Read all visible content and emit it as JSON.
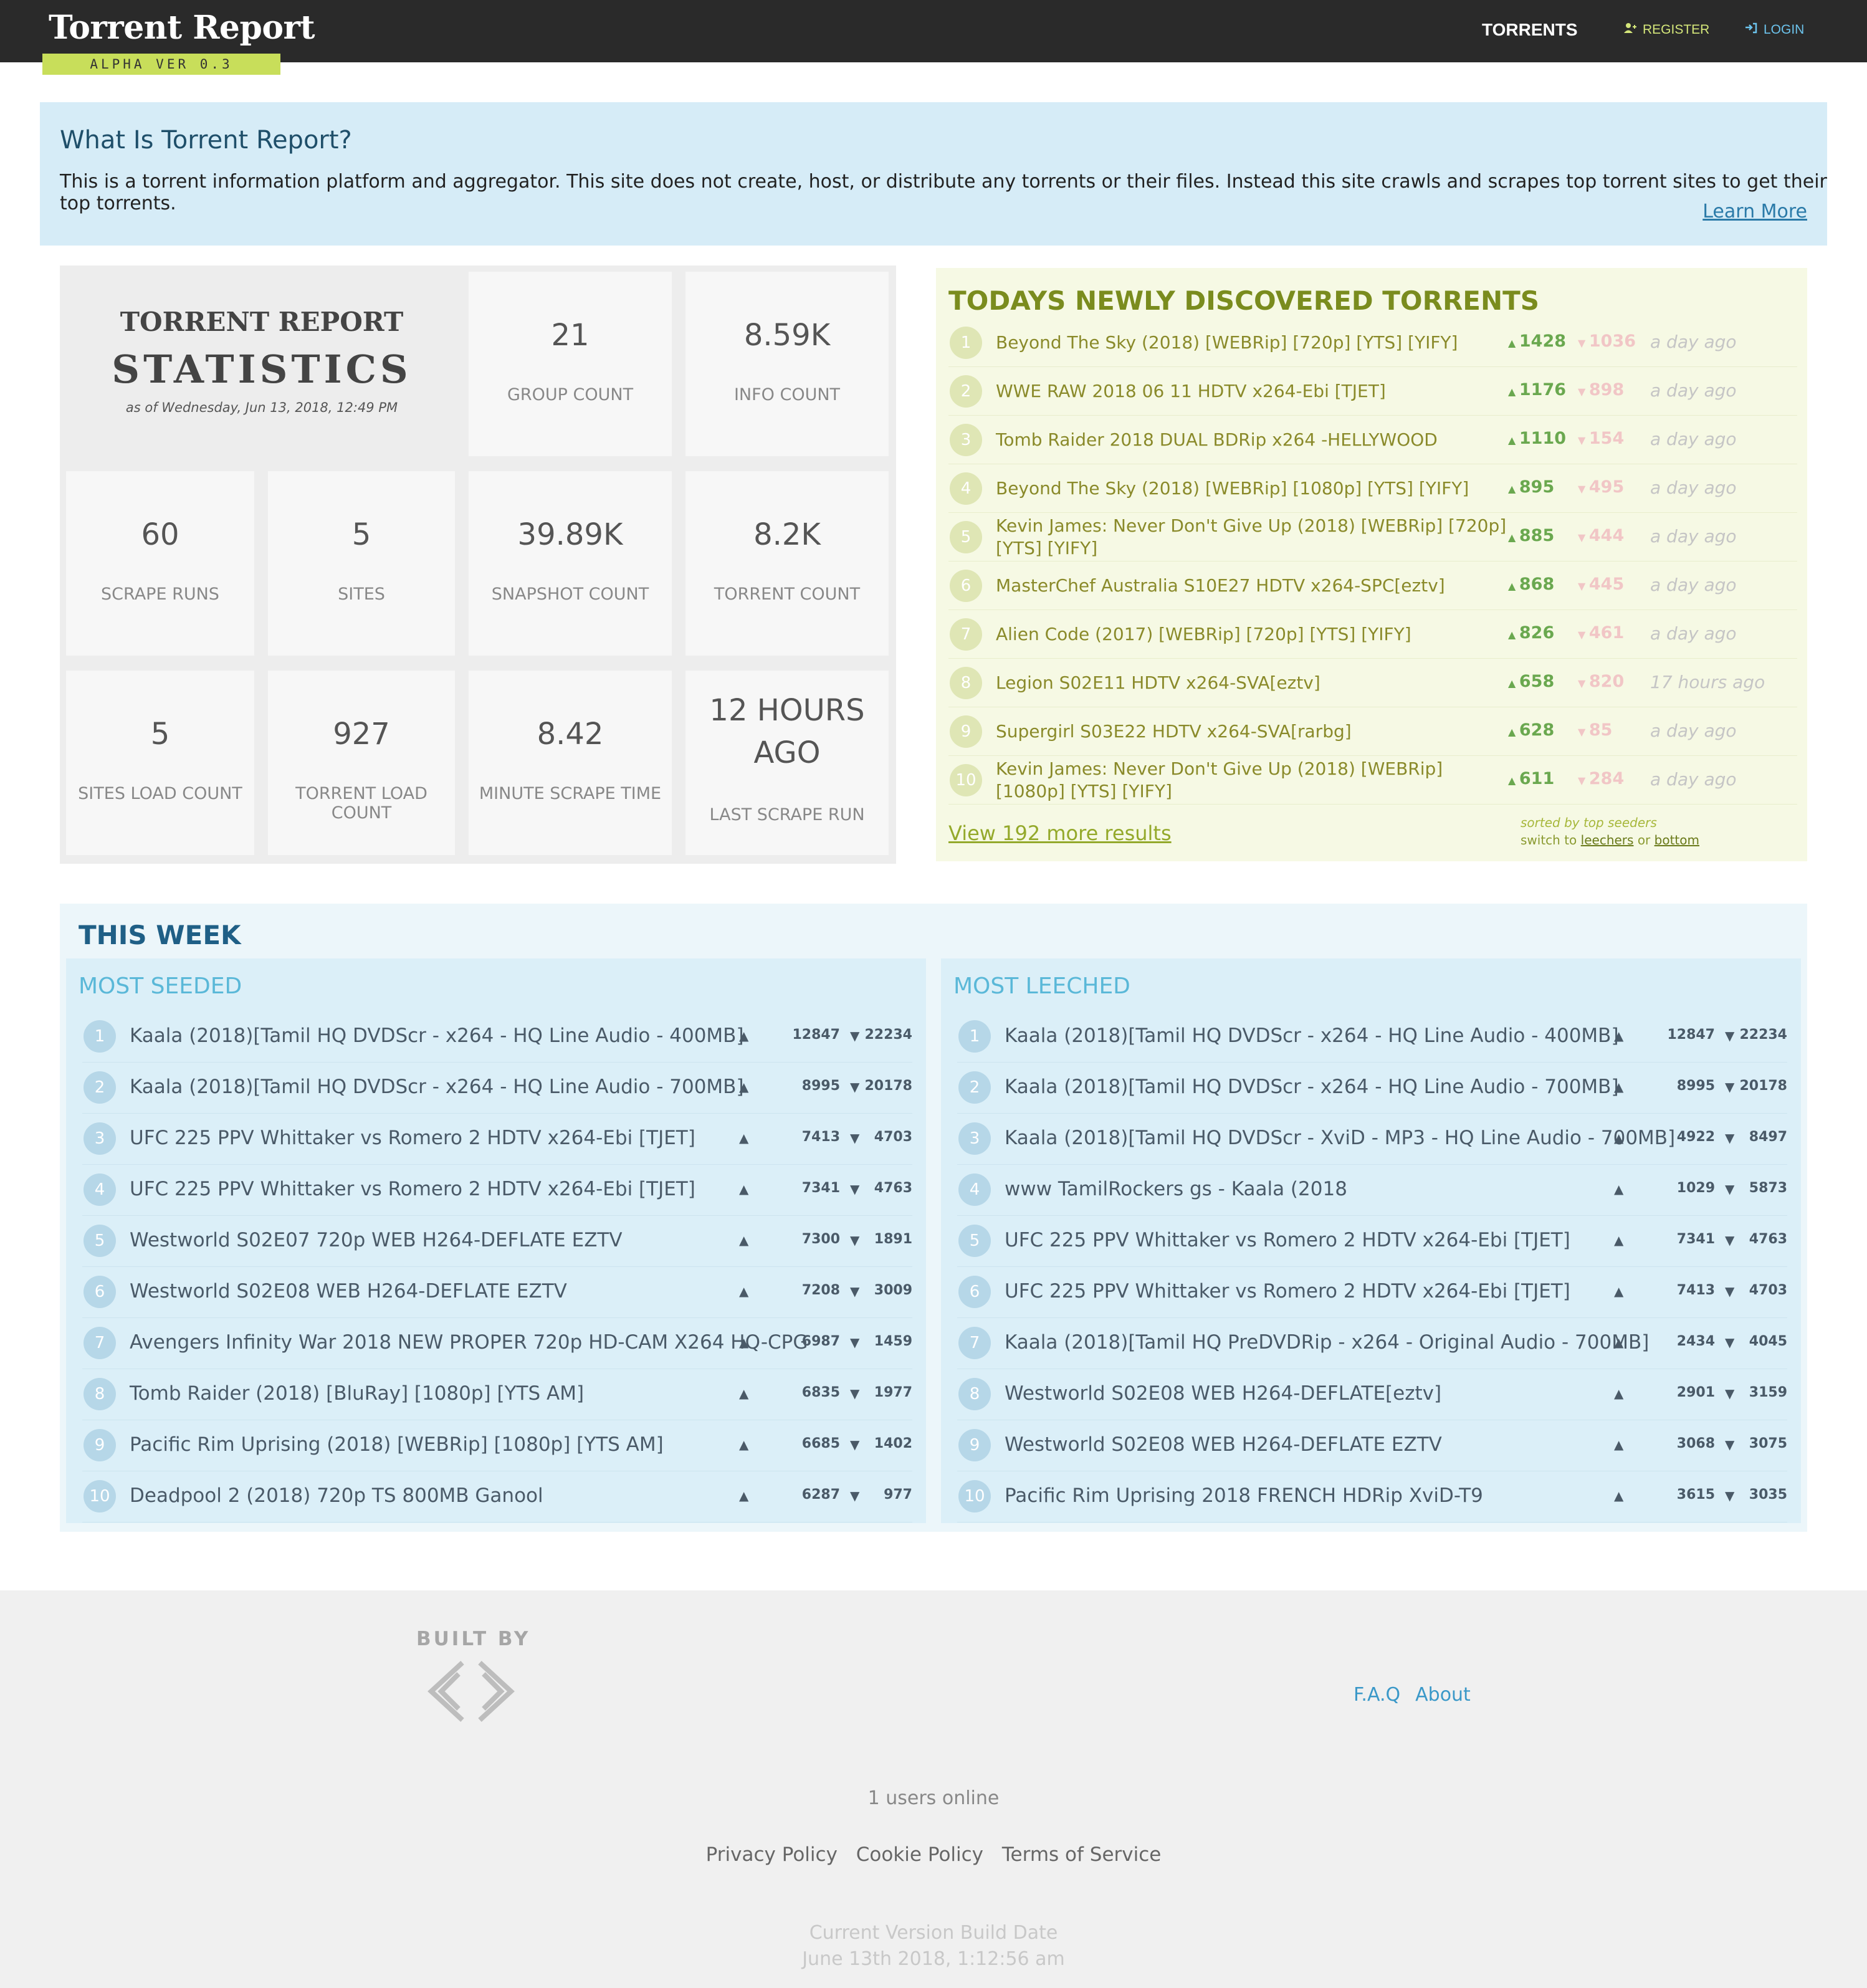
{
  "header": {
    "logo": "Torrent Report",
    "version": "ALPHA VER 0.3",
    "nav": {
      "torrents": "TORRENTS",
      "register": "REGISTER",
      "login": "LOGIN"
    }
  },
  "intro": {
    "title": "What Is Torrent Report?",
    "text": "This is a torrent information platform and aggregator. This site does not create, host, or distribute any torrents or their files. Instead this site crawls and scrapes top torrent sites to get their top torrents.",
    "learn_more": "Learn More"
  },
  "stats": {
    "heading_top": "TORRENT REPORT",
    "heading_main": "STATISTICS",
    "as_of": "as of Wednesday, Jun 13, 2018, 12:49 PM",
    "group_count": {
      "value": "21",
      "label": "GROUP COUNT"
    },
    "info_count": {
      "value": "8.59K",
      "label": "INFO COUNT"
    },
    "scrape_runs": {
      "value": "60",
      "label": "SCRAPE RUNS"
    },
    "sites": {
      "value": "5",
      "label": "SITES"
    },
    "snapshot_count": {
      "value": "39.89K",
      "label": "SNAPSHOT COUNT"
    },
    "torrent_count": {
      "value": "8.2K",
      "label": "TORRENT COUNT"
    },
    "sites_load_count": {
      "value": "5",
      "label": "SITES LOAD COUNT"
    },
    "torrent_load_count": {
      "value": "927",
      "label": "TORRENT LOAD COUNT"
    },
    "minute_scrape_time": {
      "value": "8.42",
      "label": "MINUTE SCRAPE TIME"
    },
    "last_scrape_run": {
      "value_line1": "12 HOURS",
      "value_line2": "AGO",
      "label": "LAST SCRAPE RUN"
    }
  },
  "new_torrents": {
    "title": "TODAYS NEWLY DISCOVERED TORRENTS",
    "rows": [
      {
        "num": "1",
        "name": "Beyond The Sky (2018) [WEBRip] [720p] [YTS] [YIFY]",
        "seeders": "1428",
        "leechers": "1036",
        "time": "a day ago"
      },
      {
        "num": "2",
        "name": "WWE RAW 2018 06 11 HDTV x264-Ebi [TJET]",
        "seeders": "1176",
        "leechers": "898",
        "time": "a day ago"
      },
      {
        "num": "3",
        "name": "Tomb Raider 2018 DUAL BDRip x264 -HELLYWOOD",
        "seeders": "1110",
        "leechers": "154",
        "time": "a day ago"
      },
      {
        "num": "4",
        "name": "Beyond The Sky (2018) [WEBRip] [1080p] [YTS] [YIFY]",
        "seeders": "895",
        "leechers": "495",
        "time": "a day ago"
      },
      {
        "num": "5",
        "name": "Kevin James: Never Don't Give Up (2018) [WEBRip] [720p] [YTS] [YIFY]",
        "seeders": "885",
        "leechers": "444",
        "time": "a day ago"
      },
      {
        "num": "6",
        "name": "MasterChef Australia S10E27 HDTV x264-SPC[eztv]",
        "seeders": "868",
        "leechers": "445",
        "time": "a day ago"
      },
      {
        "num": "7",
        "name": "Alien Code (2017) [WEBRip] [720p] [YTS] [YIFY]",
        "seeders": "826",
        "leechers": "461",
        "time": "a day ago"
      },
      {
        "num": "8",
        "name": "Legion S02E11 HDTV x264-SVA[eztv]",
        "seeders": "658",
        "leechers": "820",
        "time": "17 hours ago"
      },
      {
        "num": "9",
        "name": "Supergirl S03E22 HDTV x264-SVA[rarbg]",
        "seeders": "628",
        "leechers": "85",
        "time": "a day ago"
      },
      {
        "num": "10",
        "name": "Kevin James: Never Don't Give Up (2018) [WEBRip] [1080p] [YTS] [YIFY]",
        "seeders": "611",
        "leechers": "284",
        "time": "a day ago"
      }
    ],
    "view_more": "View 192 more results",
    "sorted_by": "sorted by top seeders",
    "switch_to": "switch to",
    "leechers_link": "leechers",
    "or": "or",
    "bottom_link": "bottom"
  },
  "this_week": {
    "title": "THIS WEEK",
    "most_seeded": {
      "heading": "MOST SEEDED",
      "rows": [
        {
          "num": "1",
          "name": "Kaala (2018)[Tamil HQ DVDScr - x264 - HQ Line Audio - 400MB]",
          "seeders": "12847",
          "leechers": "22234"
        },
        {
          "num": "2",
          "name": "Kaala (2018)[Tamil HQ DVDScr - x264 - HQ Line Audio - 700MB]",
          "seeders": "8995",
          "leechers": "20178"
        },
        {
          "num": "3",
          "name": "UFC 225 PPV Whittaker vs Romero 2 HDTV x264-Ebi [TJET]",
          "seeders": "7413",
          "leechers": "4703"
        },
        {
          "num": "4",
          "name": "UFC 225 PPV Whittaker vs Romero 2 HDTV x264-Ebi [TJET]",
          "seeders": "7341",
          "leechers": "4763"
        },
        {
          "num": "5",
          "name": "Westworld S02E07 720p WEB H264-DEFLATE EZTV",
          "seeders": "7300",
          "leechers": "1891"
        },
        {
          "num": "6",
          "name": "Westworld S02E08 WEB H264-DEFLATE EZTV",
          "seeders": "7208",
          "leechers": "3009"
        },
        {
          "num": "7",
          "name": "Avengers Infinity War 2018 NEW PROPER 720p HD-CAM X264 HQ-CPG",
          "seeders": "6987",
          "leechers": "1459"
        },
        {
          "num": "8",
          "name": "Tomb Raider (2018) [BluRay] [1080p] [YTS AM]",
          "seeders": "6835",
          "leechers": "1977"
        },
        {
          "num": "9",
          "name": "Pacific Rim Uprising (2018) [WEBRip] [1080p] [YTS AM]",
          "seeders": "6685",
          "leechers": "1402"
        },
        {
          "num": "10",
          "name": "Deadpool 2 (2018) 720p TS 800MB Ganool",
          "seeders": "6287",
          "leechers": "977"
        }
      ]
    },
    "most_leeched": {
      "heading": "MOST LEECHED",
      "rows": [
        {
          "num": "1",
          "name": "Kaala (2018)[Tamil HQ DVDScr - x264 - HQ Line Audio - 400MB]",
          "seeders": "12847",
          "leechers": "22234"
        },
        {
          "num": "2",
          "name": "Kaala (2018)[Tamil HQ DVDScr - x264 - HQ Line Audio - 700MB]",
          "seeders": "8995",
          "leechers": "20178"
        },
        {
          "num": "3",
          "name": "Kaala (2018)[Tamil HQ DVDScr - XviD - MP3 - HQ Line Audio - 700MB]",
          "seeders": "4922",
          "leechers": "8497"
        },
        {
          "num": "4",
          "name": "www TamilRockers gs - Kaala (2018",
          "seeders": "1029",
          "leechers": "5873"
        },
        {
          "num": "5",
          "name": "UFC 225 PPV Whittaker vs Romero 2 HDTV x264-Ebi [TJET]",
          "seeders": "7341",
          "leechers": "4763"
        },
        {
          "num": "6",
          "name": "UFC 225 PPV Whittaker vs Romero 2 HDTV x264-Ebi [TJET]",
          "seeders": "7413",
          "leechers": "4703"
        },
        {
          "num": "7",
          "name": "Kaala (2018)[Tamil HQ PreDVDRip - x264 - Original Audio - 700MB]",
          "seeders": "2434",
          "leechers": "4045"
        },
        {
          "num": "8",
          "name": "Westworld S02E08 WEB H264-DEFLATE[eztv]",
          "seeders": "2901",
          "leechers": "3159"
        },
        {
          "num": "9",
          "name": "Westworld S02E08 WEB H264-DEFLATE EZTV",
          "seeders": "3068",
          "leechers": "3075"
        },
        {
          "num": "10",
          "name": "Pacific Rim Uprising 2018 FRENCH HDRip XviD-T9",
          "seeders": "3615",
          "leechers": "3035"
        }
      ]
    }
  },
  "footer": {
    "built_by": "BUILT BY",
    "faq": "F.A.Q",
    "about": "About",
    "users_online": "1 users online",
    "privacy": "Privacy Policy",
    "cookie": "Cookie Policy",
    "terms": "Terms of Service",
    "build_label": "Current Version Build Date",
    "build_date": "June 13th 2018, 1:12:56 am"
  },
  "colors": {
    "header_bg": "#2a2a2a",
    "alpha_badge": "#c8de5a",
    "intro_bg": "#d6ecf7",
    "new_torrents_title": "#7a8c1e",
    "seeders_up": "#6aa84f",
    "leechers_down": "#f1c6c6",
    "week_title": "#1f5f86",
    "week_heading": "#5ab8d8"
  },
  "icons": {
    "register": "user-plus-icon",
    "login": "sign-in-icon",
    "up": "triangle-up-icon",
    "down": "triangle-down-icon",
    "builder_logo": "chevrons-logo-icon"
  }
}
